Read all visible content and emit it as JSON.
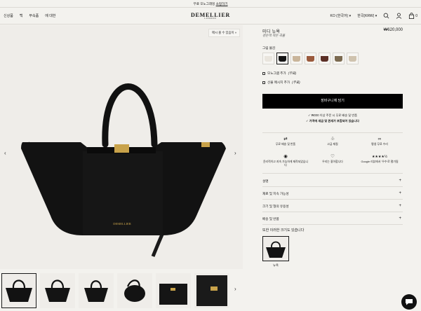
{
  "promo": {
    "text": "무료 모노그래밍",
    "link": "쇼핑하기"
  },
  "nav": {
    "links": [
      "신상품",
      "백",
      "부속품",
      "에 대한"
    ],
    "brand": "DEMELLIER",
    "brand_sub": "LONDON",
    "language": "KO (한국어)",
    "region": "한국(KRW)"
  },
  "gallery": {
    "out_of_stock_badge": "매시 볼 수 있음이 »",
    "thumbnail_count": 6
  },
  "product": {
    "title": "미디 뉴욕",
    "subtitle": "검은색 작은 곡물",
    "price": "₩620,000",
    "color_label": "그림 물감",
    "swatch_colors": [
      "#e9e5dd",
      "#141414",
      "#c9b59a",
      "#9a5a3c",
      "#5b2f25",
      "#7b6a50",
      "#cfc3ae"
    ],
    "opt_monogram": "모노그램 추가",
    "opt_monogram_price": "(무료)",
    "opt_gift": "선물 메시지 추가",
    "opt_gift_price": "(무료)",
    "cart_button": "장바구니에 담기",
    "ship_line_1": "✓ ₩200 이상 주문 시 무료 배송 및 반품",
    "ship_line_2": "✓ 가격에 세금 및 관세가 포함되어 있습니다"
  },
  "features": [
    {
      "icon": "⇄",
      "label": "무료 배송 및 반품"
    },
    {
      "icon": "♧",
      "label": "고급 재질"
    },
    {
      "icon": "∞",
      "label": "평생 무료 수리"
    },
    {
      "icon": "◉",
      "label": "윤리적이고 지속 가능하게 제작되었습니다"
    },
    {
      "icon": "♡",
      "label": "우리는 좋아합니다"
    },
    {
      "icon": "★★★★½",
      "label": "Google 리뷰에서 '우수'로 평가됨"
    }
  ],
  "accordion": [
    "설명",
    "재료 및 지속 가능성",
    "크기 및 형의 유용성",
    "배송 및 반품"
  ],
  "also_available": "또한 이러한 크기도 있습니다",
  "size_option": "뉴욕"
}
